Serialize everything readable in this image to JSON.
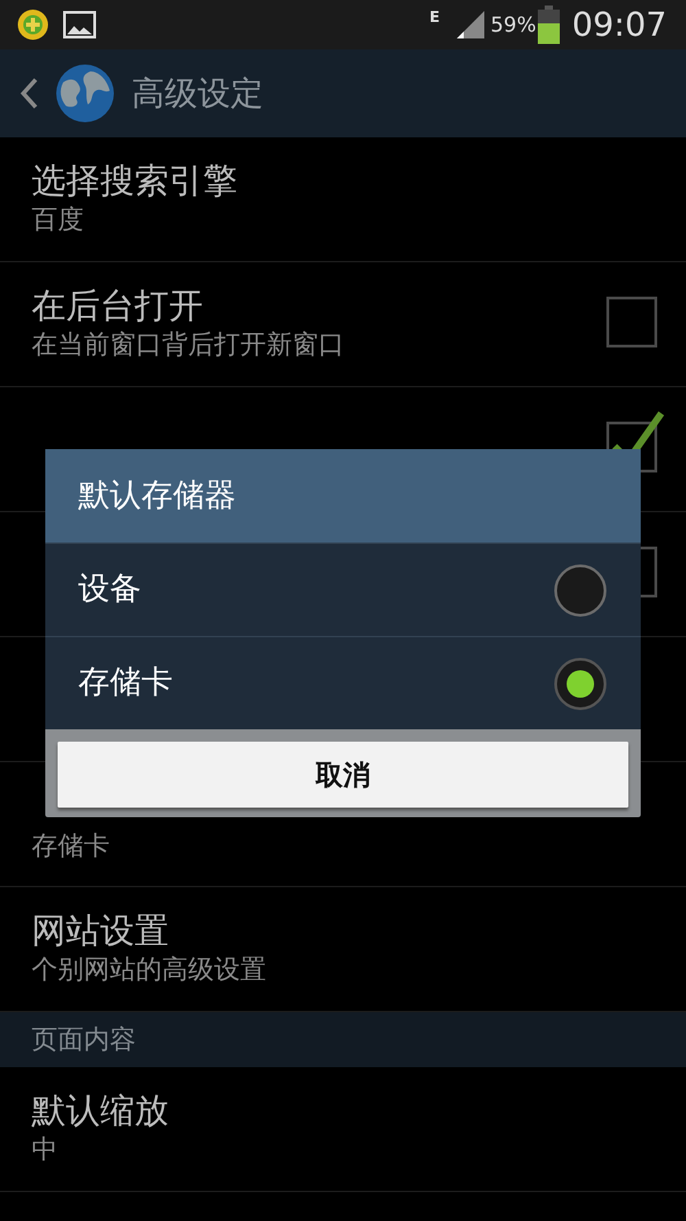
{
  "status_bar": {
    "network": "E",
    "battery_text": "59%",
    "time": "09:07"
  },
  "action_bar": {
    "title": "高级设定"
  },
  "rows": [
    {
      "kind": "setting",
      "title": "选择搜索引擎",
      "subtitle": "百度"
    },
    {
      "kind": "checkbox",
      "title": "在后台打开",
      "subtitle": "在当前窗口背后打开新窗口",
      "checked": false
    },
    {
      "kind": "checkbox",
      "checked": true
    },
    {
      "kind": "checkbox",
      "checked": false
    },
    {
      "kind": "covered"
    },
    {
      "kind": "setting",
      "subtitle": "存储卡"
    },
    {
      "kind": "setting",
      "title": "网站设置",
      "subtitle": "个别网站的高级设置"
    },
    {
      "kind": "section",
      "title": "页面内容"
    },
    {
      "kind": "setting",
      "title": "默认缩放",
      "subtitle": "中"
    }
  ],
  "dialog": {
    "title": "默认存储器",
    "options": [
      {
        "label": "设备",
        "selected": false
      },
      {
        "label": "存储卡",
        "selected": true
      }
    ],
    "button": "取消"
  }
}
